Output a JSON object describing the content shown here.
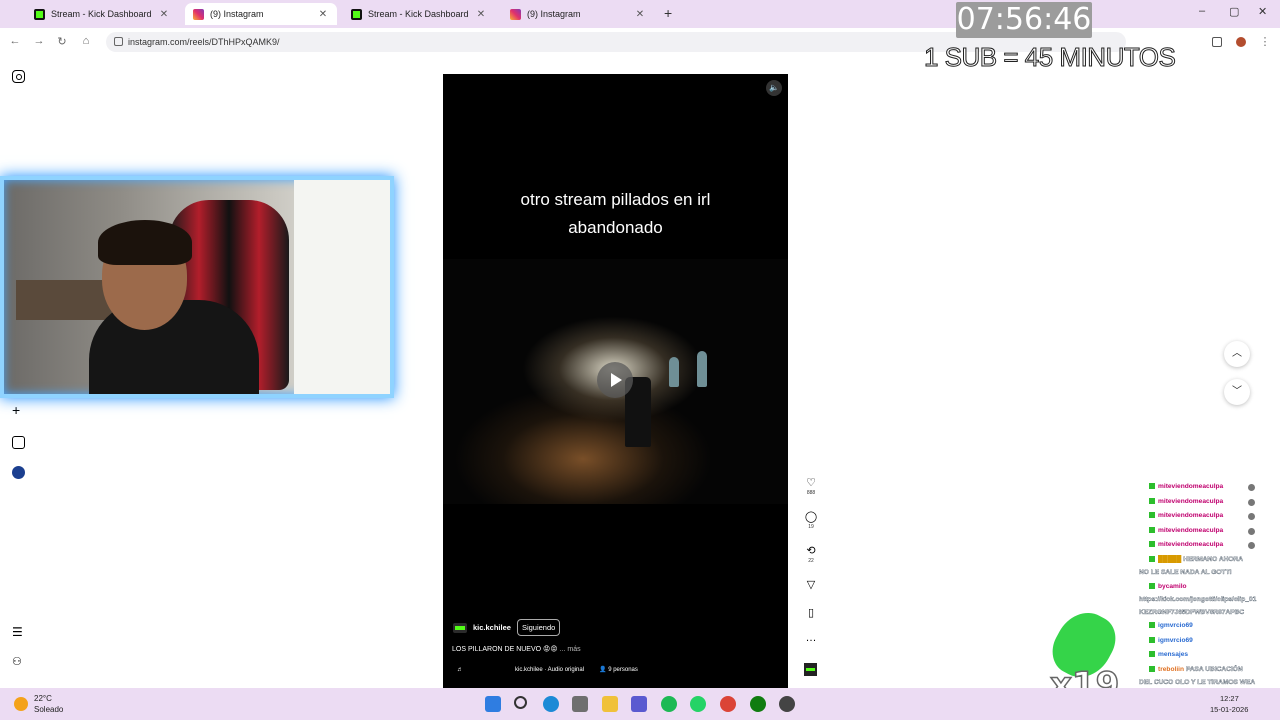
{
  "browser": {
    "tabs": [
      {
        "title": "Stream - Kick Dashboard",
        "favicon": "kick-icon"
      },
      {
        "title": "(9) Instagram",
        "favicon": "instagram-icon"
      },
      {
        "title": "Stream - Kick Dashboard",
        "favicon": "kick-icon"
      },
      {
        "title": "(9) Instagram",
        "favicon": "instagram-icon"
      }
    ],
    "active_tab_index": 1,
    "url": "instagram.com/reels/DThHPxQAMK9/",
    "new_tab_symbol": "+",
    "window_controls": {
      "minimize": "–",
      "maximize": "▢",
      "close": "✕"
    }
  },
  "overlay": {
    "timer": "07:56:46",
    "sub_rule": "1 SUB = 45 MINUTOS",
    "multiplier": "x19"
  },
  "reel": {
    "caption_overlay_line1": "otro stream pillados en irl",
    "caption_overlay_line2": "abandonado",
    "author": "kic.kchilee",
    "follow_label": "Siguiendo",
    "description": "LOS PILLARON DE NUEVO 😡😡",
    "more_label": "... más",
    "audio": "kic.kchilee · Audio original",
    "people": "9 personas",
    "likes": "888",
    "comments": "19",
    "reposts": "22"
  },
  "chat": {
    "messages": [
      {
        "user": "miteviendomeaculpa",
        "text": ""
      },
      {
        "user": "miteviendomeaculpa",
        "text": ""
      },
      {
        "user": "miteviendomeaculpa",
        "text": ""
      },
      {
        "user": "miteviendomeaculpa",
        "text": ""
      },
      {
        "user": "miteviendomeaculpa",
        "text": ""
      },
      {
        "user": "",
        "text": "HERMANO AHORA"
      },
      {
        "user": "",
        "text": "NO LE SALE NADA AL GOTTI"
      },
      {
        "user": "bycamilo",
        "text": ""
      },
      {
        "user": "",
        "text": "https://kick.com/jongotti/clips/clip_01"
      },
      {
        "user": "",
        "text": "KEZRGNF7J65DFWBV8R87APBC"
      },
      {
        "user": "igmvrcio69",
        "text": ""
      },
      {
        "user": "igmvrcio69",
        "text": ""
      },
      {
        "user": "mensajes",
        "text": ""
      },
      {
        "user": "treboliin",
        "text": "PASA UBICACIÓN"
      },
      {
        "user": "",
        "text": "DEL CUCO OLO Y LE TIRAMOS WEA"
      }
    ]
  },
  "taskbar": {
    "weather_temp": "22°C",
    "weather_desc": "Soleado",
    "time": "12:27",
    "date": "15-01-2026"
  },
  "colors": {
    "tab_strip": "#ecdcf3",
    "kick_green": "#53fc18",
    "webcam_border": "#8fd3ff",
    "reel_bg": "#000000",
    "timer_bg": "#9c9c9c"
  }
}
